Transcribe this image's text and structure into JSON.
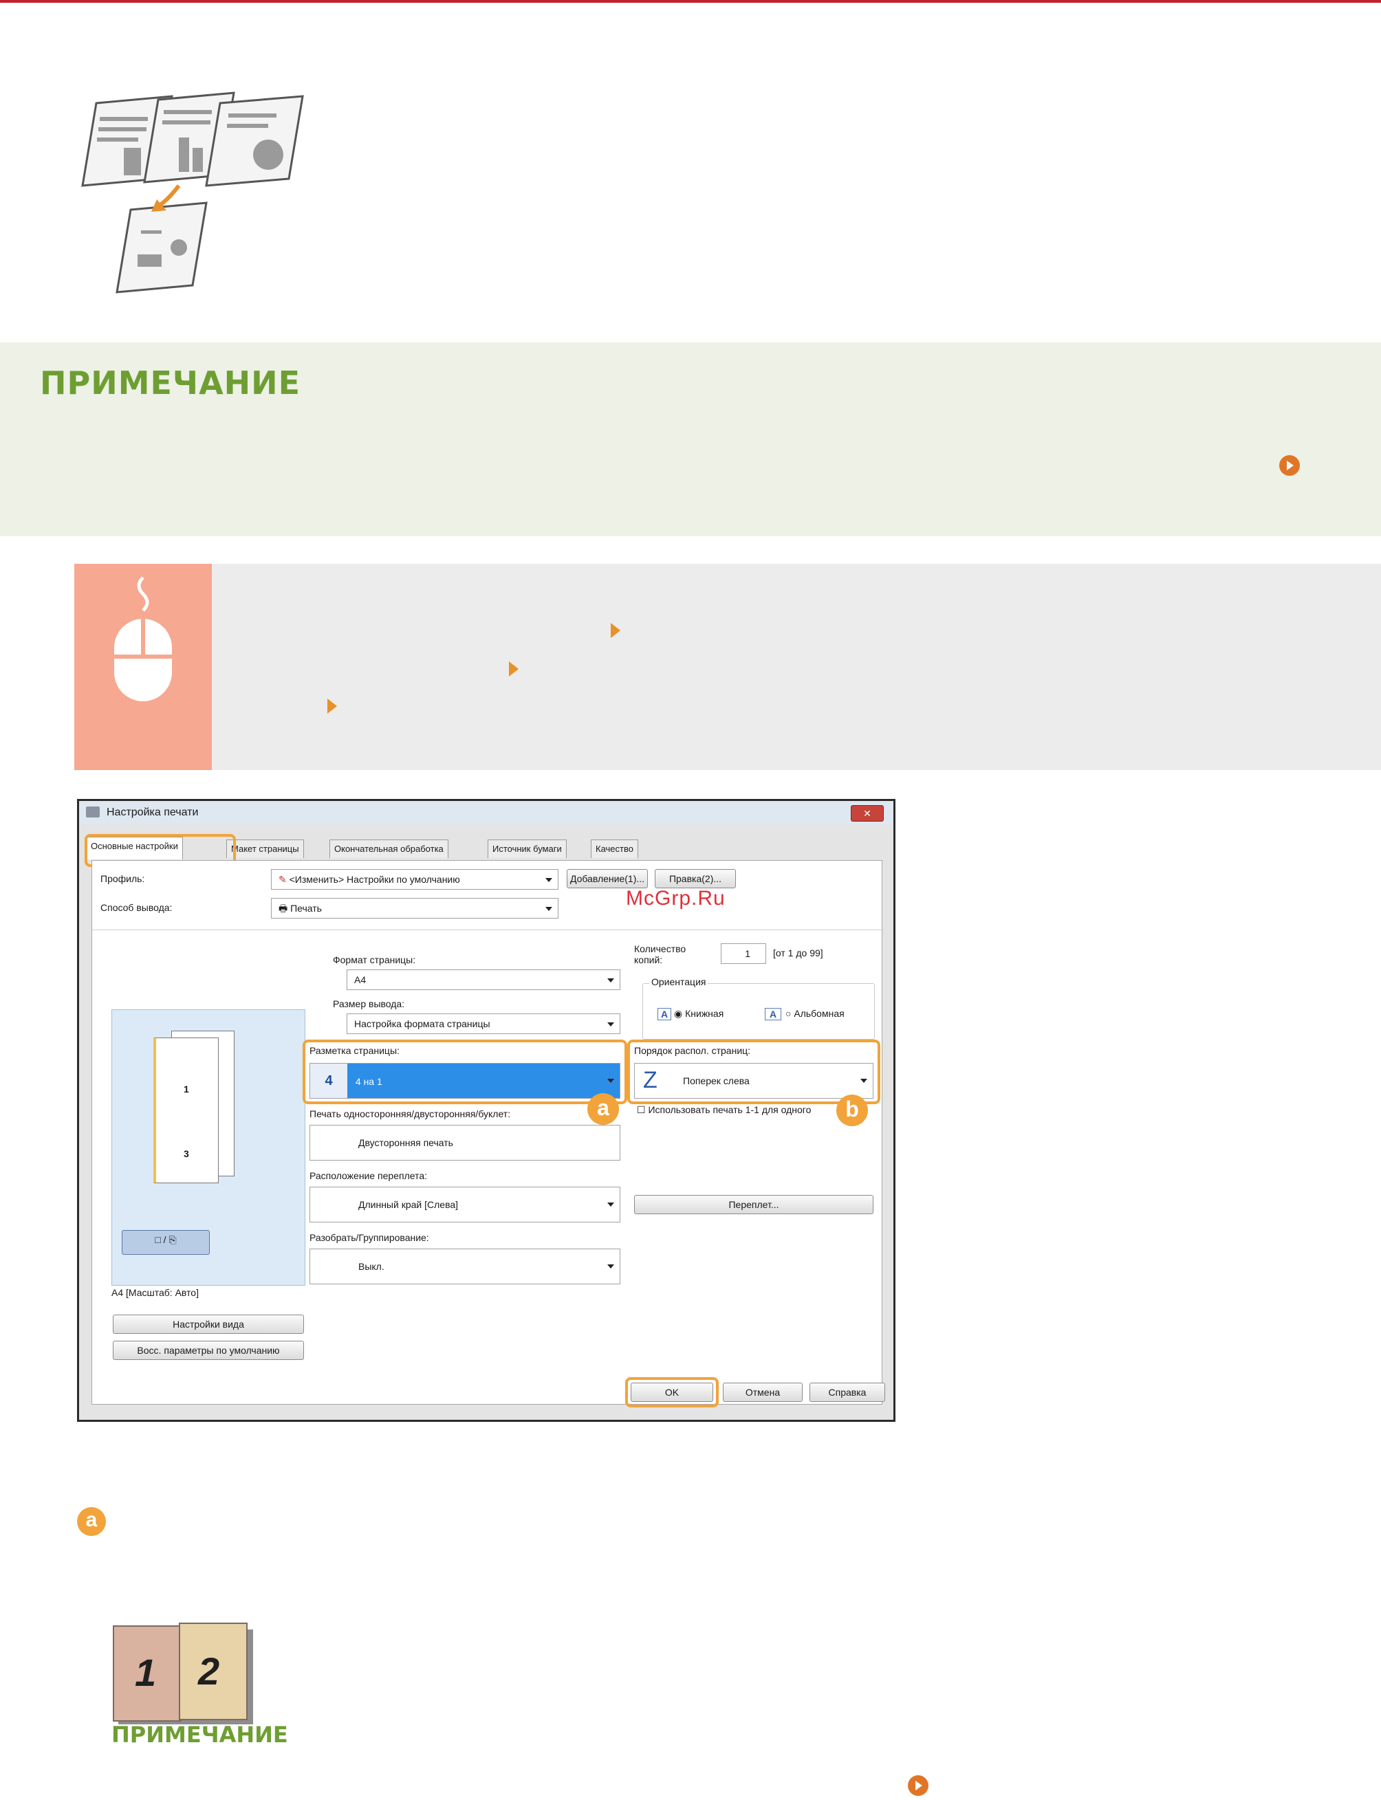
{
  "note_section": {
    "title": "ПРИМЕЧАНИЕ"
  },
  "dialog": {
    "title": "Настройка печати",
    "close_label": "✕",
    "tabs": [
      "Основные настройки",
      "Макет страницы",
      "Окончательная обработка",
      "Источник бумаги",
      "Качество"
    ],
    "profile_label": "Профиль:",
    "profile_value": "<Изменить> Настройки по умолчанию",
    "add_button": "Добавление(1)...",
    "edit_button": "Правка(2)...",
    "output_method_label": "Способ вывода:",
    "output_method_value": "Печать",
    "page_format_label": "Формат страницы:",
    "page_format_value": "A4",
    "output_size_label": "Размер вывода:",
    "output_size_value": "Настройка формата страницы",
    "copies_label": "Количество копий:",
    "copies_value": "1",
    "copies_range": "[от 1 до 99]",
    "orientation_label": "Ориентация",
    "portrait_label": "Книжная",
    "landscape_label": "Альбомная",
    "layout_label": "Разметка страницы:",
    "layout_value": "4 на 1",
    "layout_number": "4",
    "order_label": "Порядок распол. страниц:",
    "order_value": "Поперек слева",
    "use_1_1_label": "Использовать печать 1-1 для одного",
    "duplex_label": "Печать односторонняя/двусторонняя/буклет:",
    "duplex_value": "Двусторонняя печать",
    "binding_label": "Расположение переплета:",
    "binding_value": "Длинный край [Слева]",
    "binding_button": "Переплет...",
    "collate_label": "Разобрать/Группирование:",
    "collate_value": "Выкл.",
    "preview_caption": "A4 [Масштаб: Авто]",
    "preview_page_1": "1",
    "preview_page_3": "3",
    "view_settings_button": "Настройки вида",
    "restore_defaults_button": "Восс. параметры по умолчанию",
    "ok_button": "OK",
    "cancel_button": "Отмена",
    "help_button": "Справка",
    "callout_a": "a",
    "callout_b": "b"
  },
  "watermark": "McGrp.Ru",
  "section_a": {
    "badge": "a",
    "book_numbers": [
      "1",
      "2"
    ],
    "note_title": "ПРИМЕЧАНИЕ"
  }
}
